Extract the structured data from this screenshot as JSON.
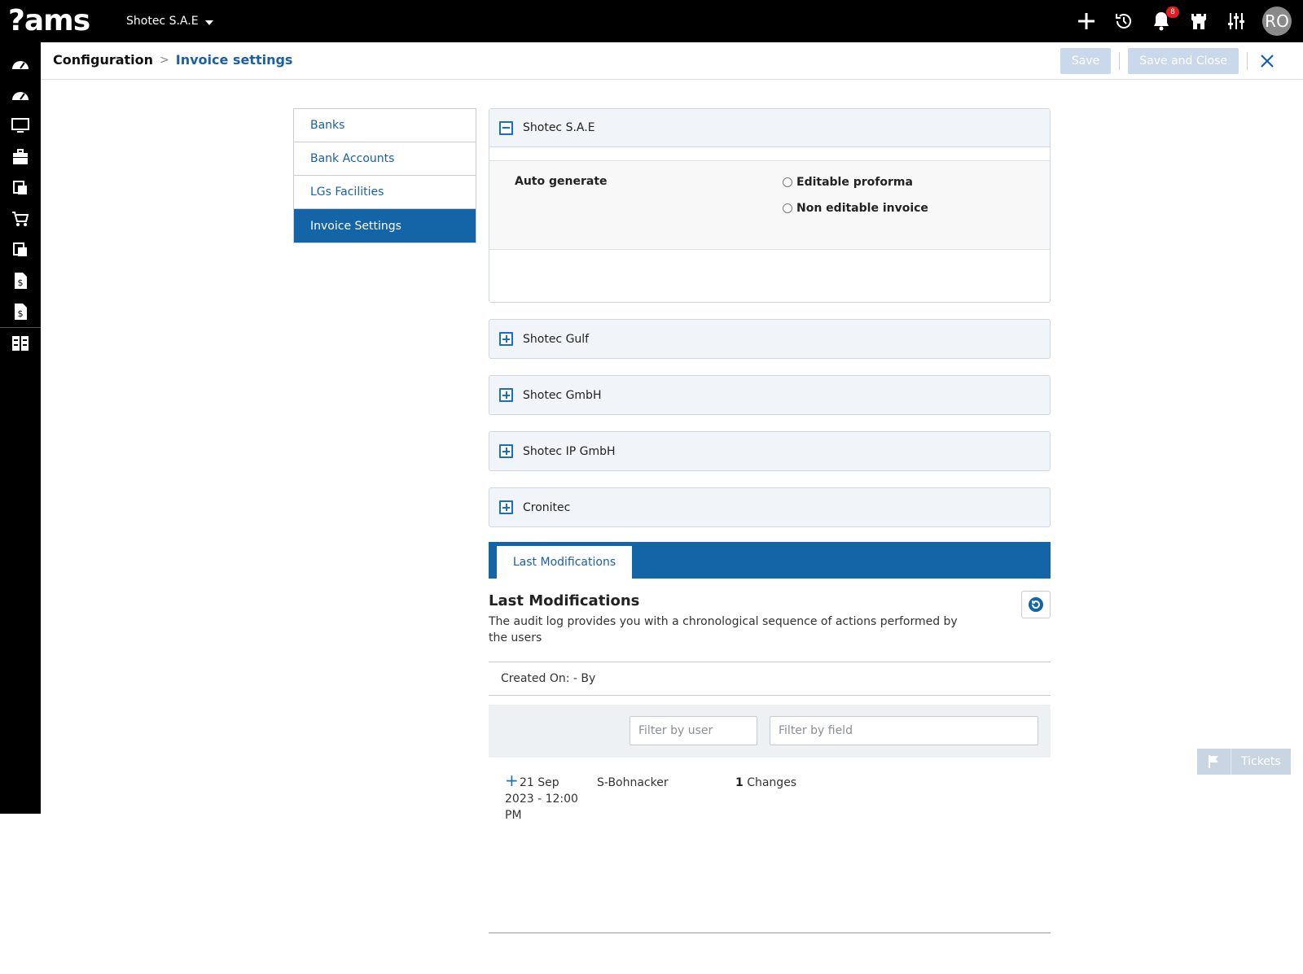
{
  "app": {
    "logo_text": "?ams",
    "company_selected": "Shotec S.A.E",
    "notification_count": "8",
    "user_initials": "RO"
  },
  "header": {
    "breadcrumb_root": "Configuration",
    "breadcrumb_separator": ">",
    "breadcrumb_current": "Invoice settings",
    "save_label": "Save",
    "save_close_label": "Save and Close"
  },
  "menu": {
    "items": [
      {
        "label": "Banks"
      },
      {
        "label": "Bank Accounts"
      },
      {
        "label": "LGs Facilities"
      },
      {
        "label": "Invoice Settings"
      }
    ]
  },
  "panels": [
    {
      "title": "Shotec S.A.E",
      "expanded": true
    },
    {
      "title": "Shotec Gulf"
    },
    {
      "title": "Shotec GmbH"
    },
    {
      "title": "Shotec IP GmbH"
    },
    {
      "title": "Cronitec"
    }
  ],
  "auto_generate": {
    "label": "Auto generate",
    "options": [
      "Editable proforma",
      "Non editable invoice"
    ]
  },
  "last_modifications": {
    "tab_label": "Last Modifications",
    "title": "Last Modifications",
    "description": "The audit log provides you with a chronological sequence of actions performed by the users",
    "created_on": "Created On: - By",
    "filter_user_placeholder": "Filter by user",
    "filter_field_placeholder": "Filter by field",
    "entries": [
      {
        "date": "21 Sep 2023 - 12:00 PM",
        "user": "S-Bohnacker",
        "changes_count": "1",
        "changes_label": "Changes"
      }
    ]
  },
  "tickets": {
    "label": "Tickets"
  },
  "colors": {
    "primary": "#1465a8",
    "link": "#1a5fa8",
    "disabled_button": "#c9d8ea",
    "badge": "#e02020"
  }
}
